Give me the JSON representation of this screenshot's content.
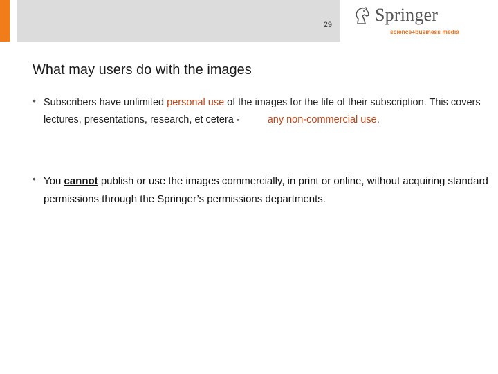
{
  "header": {
    "page_number": "29",
    "logo": {
      "name": "Springer",
      "tagline": "science+business media"
    },
    "colors": {
      "accent": "#f07d1a",
      "band": "#dcdcdc",
      "highlight": "#c0461a"
    }
  },
  "title": "What may users do with the images",
  "bullets": [
    {
      "p1": "Subscribers have unlimited ",
      "h1": "personal use",
      "p2": " of the images for the life of their subscription. This covers lectures, presentations, research, et cetera -",
      "h2a": "any non-commercial",
      "h2b": "use",
      "p3": "."
    },
    {
      "p1": "You ",
      "emph": "cannot",
      "p2": " publish or use the images commercially, in print or online, without acquiring standard permissions through the Springer’s permissions departments."
    }
  ]
}
